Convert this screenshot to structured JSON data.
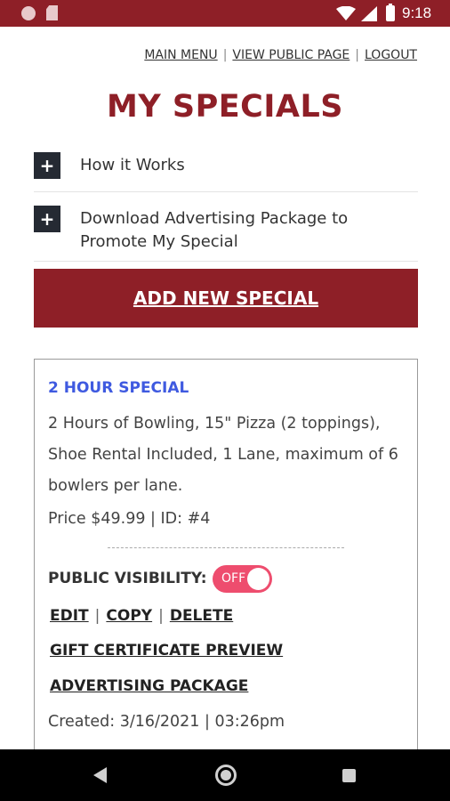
{
  "status_bar": {
    "time": "9:18",
    "icons": [
      "notification-dot-icon",
      "sd-card-icon",
      "wifi-icon",
      "signal-icon",
      "battery-icon"
    ],
    "color": "#8e1f27"
  },
  "top_links": {
    "main_menu": "MAIN MENU",
    "separator": "|",
    "view_public_page": "VIEW PUBLIC PAGE",
    "logout": "LOGOUT"
  },
  "page_title": "MY SPECIALS",
  "accordion": [
    {
      "icon": "plus-icon",
      "label": "How it Works"
    },
    {
      "icon": "plus-icon",
      "label": "Download Advertising Package to Promote My Special"
    }
  ],
  "add_button_label": "ADD NEW SPECIAL",
  "special": {
    "title": "2 HOUR SPECIAL",
    "description": "2 Hours of Bowling, 15\" Pizza (2 toppings), Shoe Rental Included, 1 Lane, maximum of 6 bowlers per lane.",
    "price_line": "Price $49.99 | ID: #4",
    "visibility_label": "PUBLIC VISIBILITY:",
    "toggle_text": "OFF",
    "toggle_on": false,
    "actions": {
      "edit": "EDIT",
      "copy": "COPY",
      "delete": "DELETE",
      "separator": "|"
    },
    "gift_certificate_link": "GIFT CERTIFICATE PREVIEW",
    "advertising_package_link": "ADVERTISING PACKAGE",
    "created": "Created: 3/16/2021 | 03:26pm"
  },
  "nav_bar": {
    "icons": [
      "back-icon",
      "home-icon",
      "recent-apps-icon"
    ]
  },
  "colors": {
    "brand": "#8e1f27",
    "special_title": "#3f5ae0",
    "toggle": "#ee4d6e",
    "accordion_box": "#252a33"
  }
}
